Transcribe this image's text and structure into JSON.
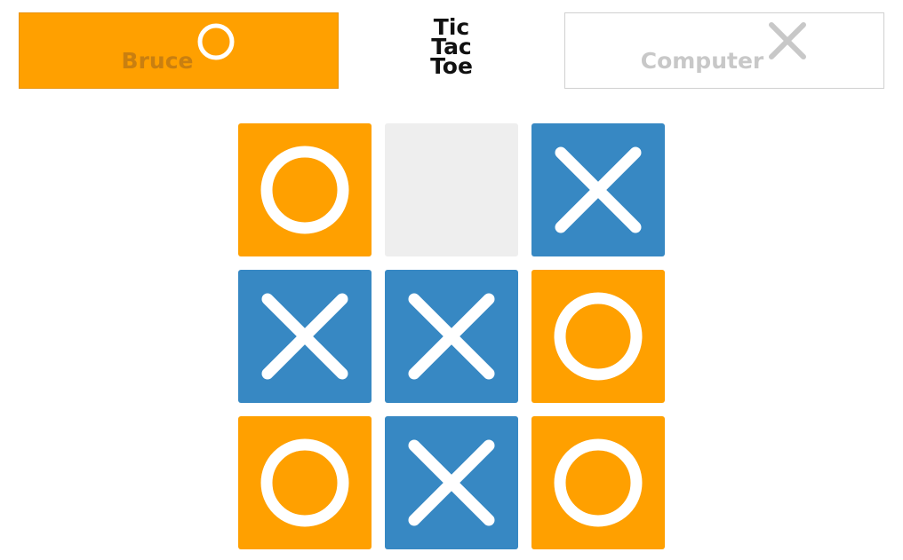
{
  "players": [
    {
      "name": "Bruce",
      "mark": "o",
      "active": true
    },
    {
      "name": "Computer",
      "mark": "x",
      "active": false
    }
  ],
  "title": [
    "Tic",
    "Tac",
    "Toe"
  ],
  "board": [
    "o",
    "",
    "x",
    "x",
    "x",
    "o",
    "o",
    "x",
    "o"
  ],
  "colors": {
    "o": "#FFA000",
    "x": "#3788C3",
    "empty": "#EEEEEE",
    "mark": "#ffffff"
  }
}
